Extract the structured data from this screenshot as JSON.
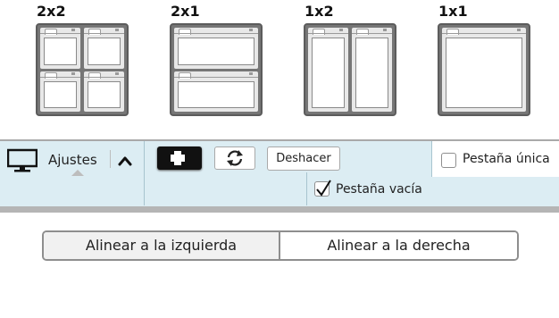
{
  "layouts": [
    {
      "label": "2x2",
      "columns": 2,
      "rows": 2
    },
    {
      "label": "2x1",
      "columns": 1,
      "rows": 2
    },
    {
      "label": "1x2",
      "columns": 2,
      "rows": 1
    },
    {
      "label": "1x1",
      "columns": 1,
      "rows": 1
    }
  ],
  "toolbar": {
    "settings_label": "Ajustes",
    "undo_label": "Deshacer",
    "single_tab_label": "Pestaña única",
    "single_tab_checked": false,
    "empty_tab_label": "Pestaña vacía",
    "empty_tab_checked": true
  },
  "alignment": {
    "left_label": "Alinear a la izquierda",
    "right_label": "Alinear a la derecha",
    "selected": "left"
  },
  "colors": {
    "toolbar_bg": "#dcedf3",
    "frame_gray": "#767676",
    "add_button_bg": "#111111"
  },
  "icons": [
    "monitor-icon",
    "chevron-up-icon",
    "plus-icon",
    "refresh-icon",
    "checkmark-icon"
  ]
}
